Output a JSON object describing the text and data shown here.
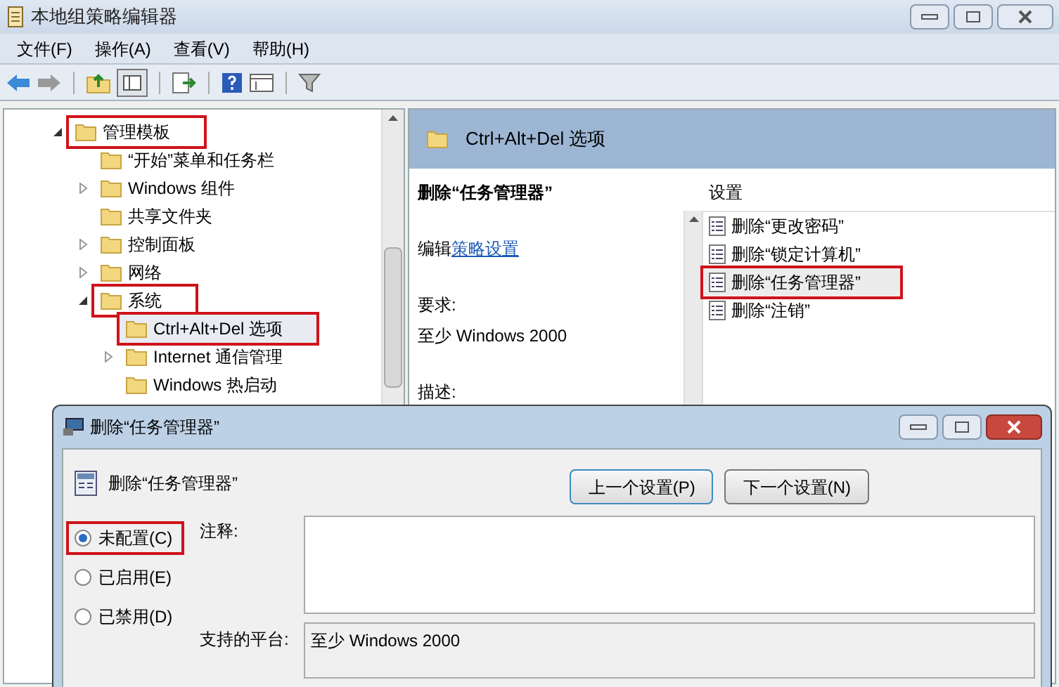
{
  "window": {
    "title": "本地组策略编辑器"
  },
  "menu": [
    "文件(F)",
    "操作(A)",
    "查看(V)",
    "帮助(H)"
  ],
  "tree": [
    {
      "label": "管理模板",
      "expanded": true,
      "selected": false,
      "highlighted": true,
      "children": [
        {
          "label": "“开始”菜单和任务栏",
          "selected": false,
          "highlighted": false
        },
        {
          "label": "Windows 组件",
          "expanded": false,
          "selected": false,
          "highlighted": false
        },
        {
          "label": "共享文件夹",
          "selected": false,
          "highlighted": false
        },
        {
          "label": "控制面板",
          "expanded": false,
          "selected": false,
          "highlighted": false
        },
        {
          "label": "网络",
          "expanded": false,
          "selected": false,
          "highlighted": false
        },
        {
          "label": "系统",
          "expanded": true,
          "selected": false,
          "highlighted": true,
          "children": [
            {
              "label": "Ctrl+Alt+Del 选项",
              "selected": true,
              "highlighted": true
            },
            {
              "label": "Internet 通信管理",
              "expanded": false,
              "selected": false,
              "highlighted": false
            },
            {
              "label": "Windows 热启动",
              "selected": false,
              "highlighted": false
            }
          ]
        }
      ]
    }
  ],
  "detail": {
    "header": "Ctrl+Alt+Del 选项",
    "policy_title": "删除“任务管理器”",
    "edit_prefix": "编辑",
    "edit_link": "策略设置",
    "requirement_label": "要求:",
    "requirement": "至少 Windows 2000",
    "description_label": "描述:"
  },
  "settings": {
    "heading": "设置",
    "items": [
      {
        "label": "删除“更改密码”",
        "selected": false,
        "highlighted": false
      },
      {
        "label": "删除“锁定计算机”",
        "selected": false,
        "highlighted": false
      },
      {
        "label": "删除“任务管理器”",
        "selected": true,
        "highlighted": true
      },
      {
        "label": "删除“注销”",
        "selected": false,
        "highlighted": false
      }
    ]
  },
  "dialog": {
    "title": "删除“任务管理器”",
    "policy_name": "删除“任务管理器”",
    "buttons": [
      "上一个设置(P)",
      "下一个设置(N)"
    ],
    "options": [
      {
        "label": "未配置(C)",
        "selected": true,
        "highlighted": true
      },
      {
        "label": "已启用(E)",
        "selected": false,
        "highlighted": false
      },
      {
        "label": "已禁用(D)",
        "selected": false,
        "highlighted": false
      }
    ],
    "comment_label": "注释:",
    "platform_label": "支持的平台:",
    "platform": "至少 Windows 2000"
  }
}
